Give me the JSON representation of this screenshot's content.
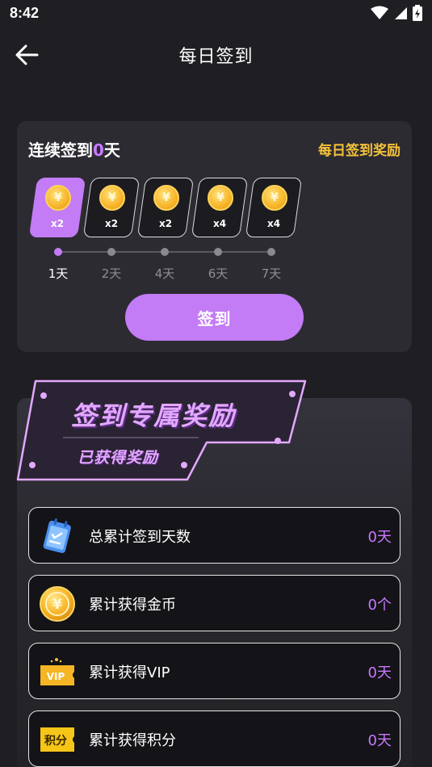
{
  "status_bar": {
    "time": "8:42"
  },
  "header": {
    "title": "每日签到"
  },
  "checkin": {
    "streak_prefix": "连续签到",
    "streak_days": "0",
    "streak_suffix": "天",
    "reward_link": "每日签到奖励",
    "tiles": [
      {
        "mult": "x2",
        "coin_symbol": "¥"
      },
      {
        "mult": "x2",
        "coin_symbol": "¥"
      },
      {
        "mult": "x2",
        "coin_symbol": "¥"
      },
      {
        "mult": "x4",
        "coin_symbol": "¥"
      },
      {
        "mult": "x4",
        "coin_symbol": "¥"
      }
    ],
    "days": [
      "1天",
      "2天",
      "4天",
      "6天",
      "7天"
    ],
    "button_label": "签到"
  },
  "rewards": {
    "banner_title": "签到专属奖励",
    "banner_subtitle": "已获得奖励",
    "stats": [
      {
        "label": "总累计签到天数",
        "value": "0天",
        "icon": "calendar-icon"
      },
      {
        "label": "累计获得金币",
        "value": "0个",
        "icon": "gold-coin-icon"
      },
      {
        "label": "累计获得VIP",
        "value": "0天",
        "icon": "vip-ticket-icon",
        "icon_text": "VIP"
      },
      {
        "label": "累计获得积分",
        "value": "0天",
        "icon": "points-ticket-icon",
        "icon_text": "积分"
      }
    ]
  },
  "colors": {
    "accent": "#c37cf5",
    "gold": "#f5c23a",
    "background": "#1f1e23"
  }
}
